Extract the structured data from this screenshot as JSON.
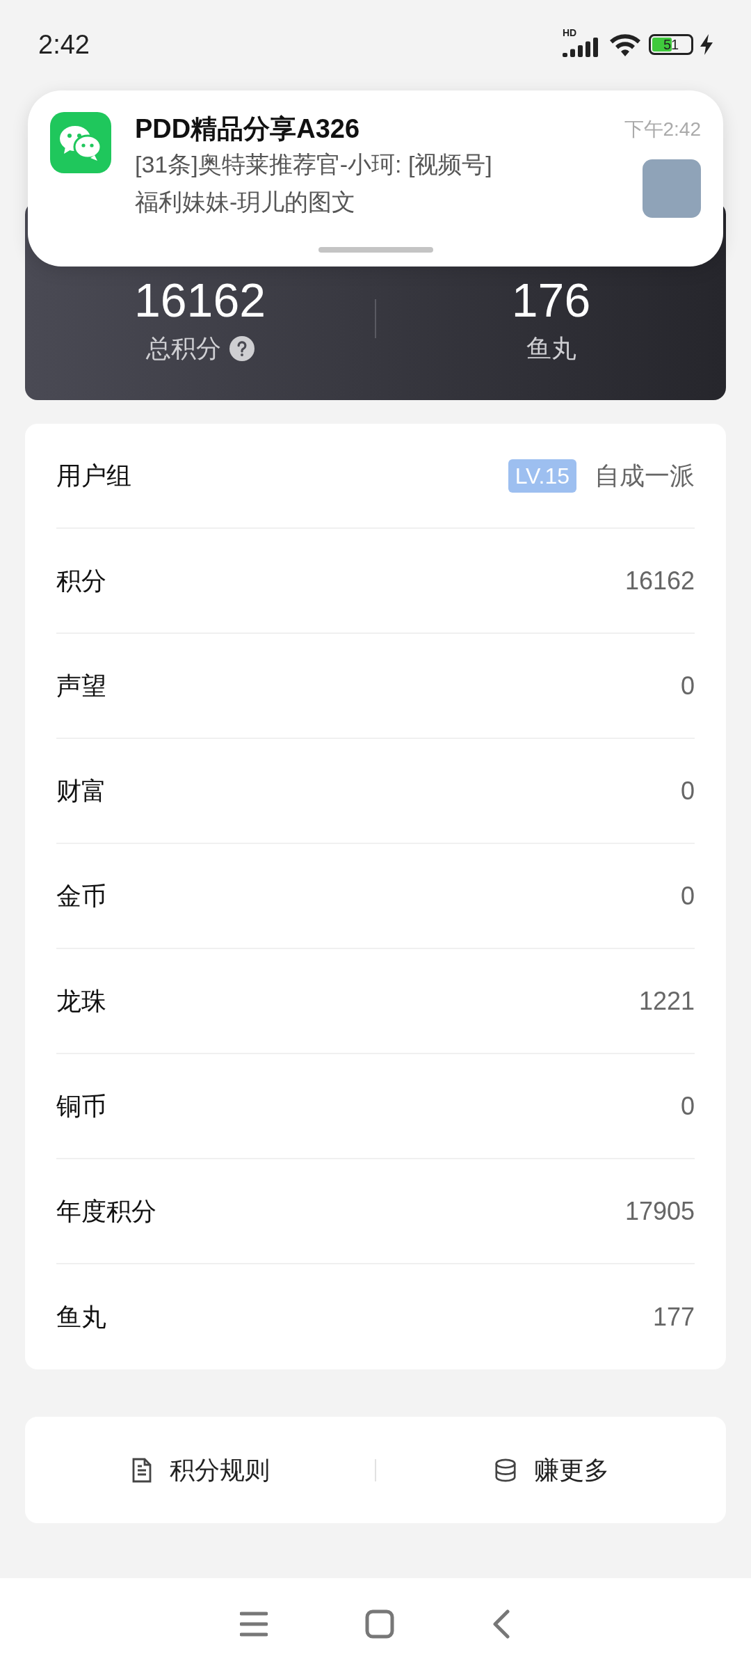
{
  "status_bar": {
    "time": "2:42",
    "network": "HD",
    "battery": {
      "text": "51",
      "level": 0.51,
      "charging": true
    }
  },
  "notification": {
    "app_title": "PDD精品分享A326",
    "time": "下午2:42",
    "message_lines": [
      "[31条]奥特莱推荐官-小珂: [视频号]",
      "福利妹妹-玥儿的图文"
    ]
  },
  "summary": [
    {
      "value": "16162",
      "label": "总积分",
      "help": true
    },
    {
      "value": "176",
      "label": "鱼丸",
      "help": false
    }
  ],
  "rows": [
    {
      "label": "用户组",
      "badge": "LV.15",
      "value": "自成一派"
    },
    {
      "label": "积分",
      "value": "16162"
    },
    {
      "label": "声望",
      "value": "0"
    },
    {
      "label": "财富",
      "value": "0"
    },
    {
      "label": "金币",
      "value": "0"
    },
    {
      "label": "龙珠",
      "value": "1221"
    },
    {
      "label": "铜币",
      "value": "0"
    },
    {
      "label": "年度积分",
      "value": "17905"
    },
    {
      "label": "鱼丸",
      "value": "177"
    }
  ],
  "actions": [
    {
      "kind": "document",
      "label": "积分规则"
    },
    {
      "kind": "coins",
      "label": "赚更多"
    }
  ]
}
